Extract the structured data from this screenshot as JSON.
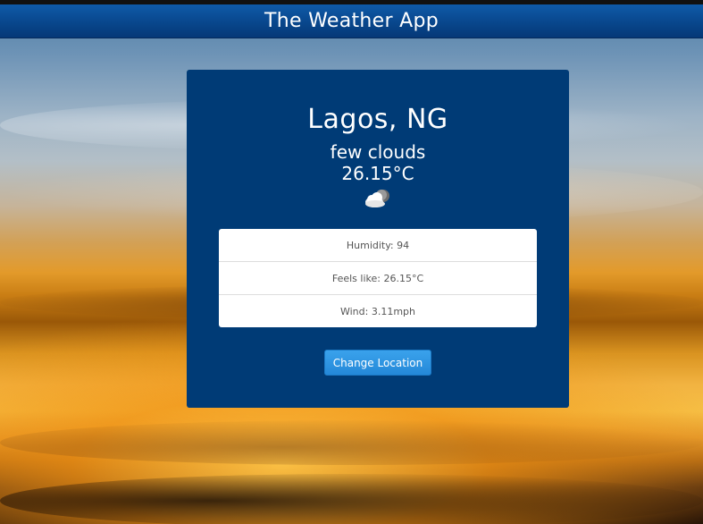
{
  "header": {
    "title": "The Weather App"
  },
  "weather": {
    "location": "Lagos, NG",
    "description": "few clouds",
    "temperature": "26.15°C",
    "icon": "few-clouds-night-icon"
  },
  "details": [
    {
      "label": "Humidity: 94"
    },
    {
      "label": "Feels like: 26.15°C"
    },
    {
      "label": "Wind: 3.11mph"
    }
  ],
  "actions": {
    "change_location_label": "Change Location"
  },
  "colors": {
    "header": "#08458a",
    "card": "#003b76",
    "button": "#2a8ddc",
    "sky_sunset": "#f2b341"
  }
}
